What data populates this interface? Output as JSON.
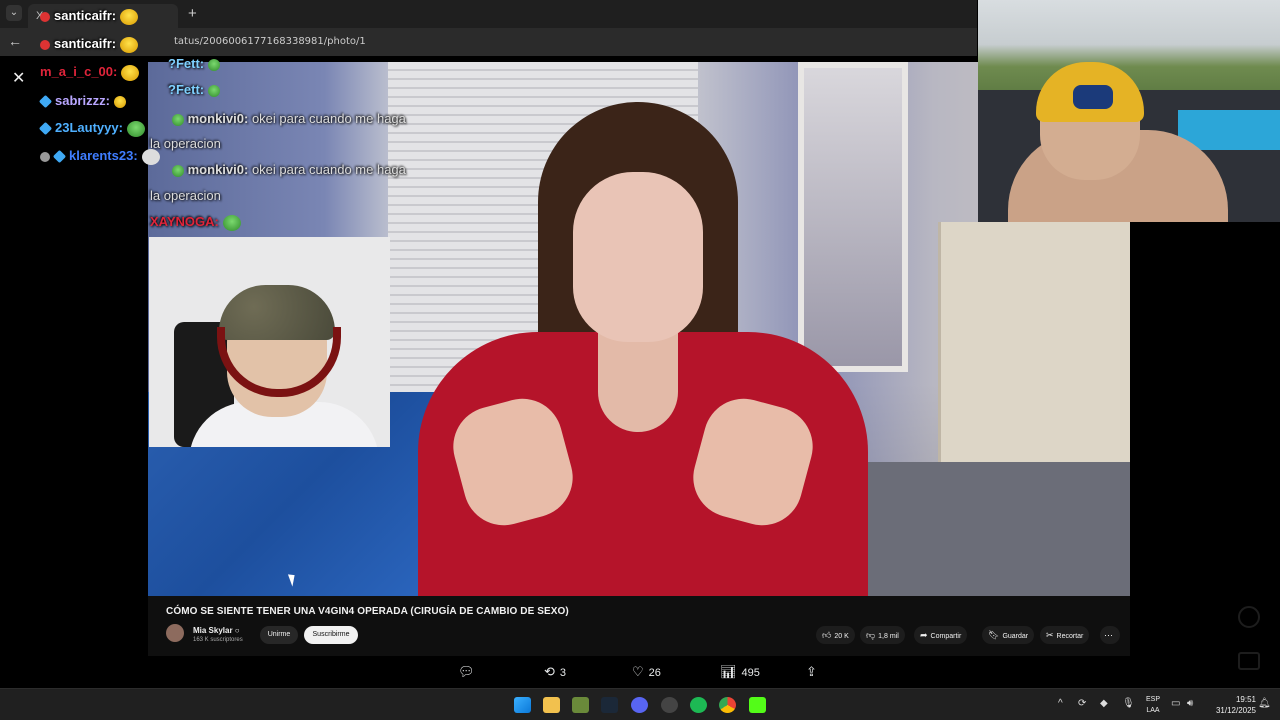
{
  "browser": {
    "tab_title": "X",
    "new_tab": "+",
    "url": "tatus/2006006177168338981/photo/1"
  },
  "chat": [
    {
      "user": "santicaifr:",
      "color": "#ffffff"
    },
    {
      "user": "santicaifr:",
      "color": "#ffffff"
    },
    {
      "user": "m_a_i_c_00:",
      "color": "#e0243a"
    },
    {
      "user": "sabrizzz:",
      "color": "#b9a7ff"
    },
    {
      "user": "23Lautyyy:",
      "color": "#4fb0ff"
    },
    {
      "user": "klarents23:",
      "color": "#3f7dff"
    }
  ],
  "video_chat": [
    {
      "user": "?Fett:",
      "text": ""
    },
    {
      "user": "?Fett:",
      "text": ""
    },
    {
      "user": "monkivi0:",
      "text": "okei para cuando me haga"
    },
    {
      "user": "",
      "text": "la operacion"
    },
    {
      "user": "monkivi0:",
      "text": "okei para cuando me haga"
    },
    {
      "user": "",
      "text": "la operacion"
    },
    {
      "user": "XAYNOGA:",
      "text": ""
    }
  ],
  "video": {
    "title": "CÓMO SE SIENTE TENER UNA V4GIN4 OPERADA (CIRUGÍA DE CAMBIO DE SEXO)",
    "channel": "Mia Skylar ○",
    "subscribers": "163 K suscriptores",
    "join_label": "Unirme",
    "subscribe_label": "Suscribirme",
    "likes": "20 K",
    "dislikes": "1,8 mil",
    "share_label": "Compartir",
    "save_label": "Guardar",
    "clip_label": "Recortar"
  },
  "tweet_actions": {
    "reply": "",
    "retweets": "3",
    "likes": "26",
    "views": "495"
  },
  "taskbar": {
    "lang_line1": "ESP",
    "lang_line2": "LAA",
    "time": "19:51",
    "date": "31/12/2025"
  },
  "colors": {
    "background": "#000000",
    "accent_red": "#b5142a",
    "youtube_bg": "#0f0f0f"
  }
}
